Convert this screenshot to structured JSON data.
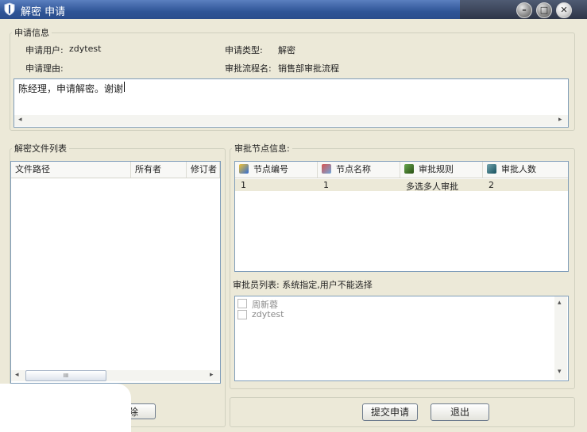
{
  "window": {
    "title": "解密 申请"
  },
  "request_info": {
    "legend": "申请信息",
    "user_label": "申请用户:",
    "user_value": "zdytest",
    "type_label": "申请类型:",
    "type_value": "解密",
    "reason_label": "申请理由:",
    "flow_label": "审批流程名:",
    "flow_value": "销售部审批流程",
    "reason_text": "陈经理，申请解密。谢谢"
  },
  "file_list": {
    "legend": "解密文件列表",
    "columns": [
      "文件路径",
      "所有者",
      "修订者"
    ],
    "remove_button_partial": "除"
  },
  "approval_nodes": {
    "legend": "审批节点信息:",
    "columns": [
      "节点编号",
      "节点名称",
      "审批规则",
      "审批人数"
    ],
    "rows": [
      {
        "id": "1",
        "name": "1",
        "rule": "多选多人审批",
        "count": "2"
      }
    ]
  },
  "approvers": {
    "label": "审批员列表: 系统指定,用户不能选择",
    "items": [
      "周新蓉",
      "zdytest"
    ]
  },
  "footer": {
    "submit": "提交申请",
    "exit": "退出"
  },
  "scroll": {
    "thumb": "III"
  },
  "colors": {
    "title_blue": "#2f5597",
    "selected_row": "#ece9d8",
    "window_bg": "#ece9d8"
  }
}
